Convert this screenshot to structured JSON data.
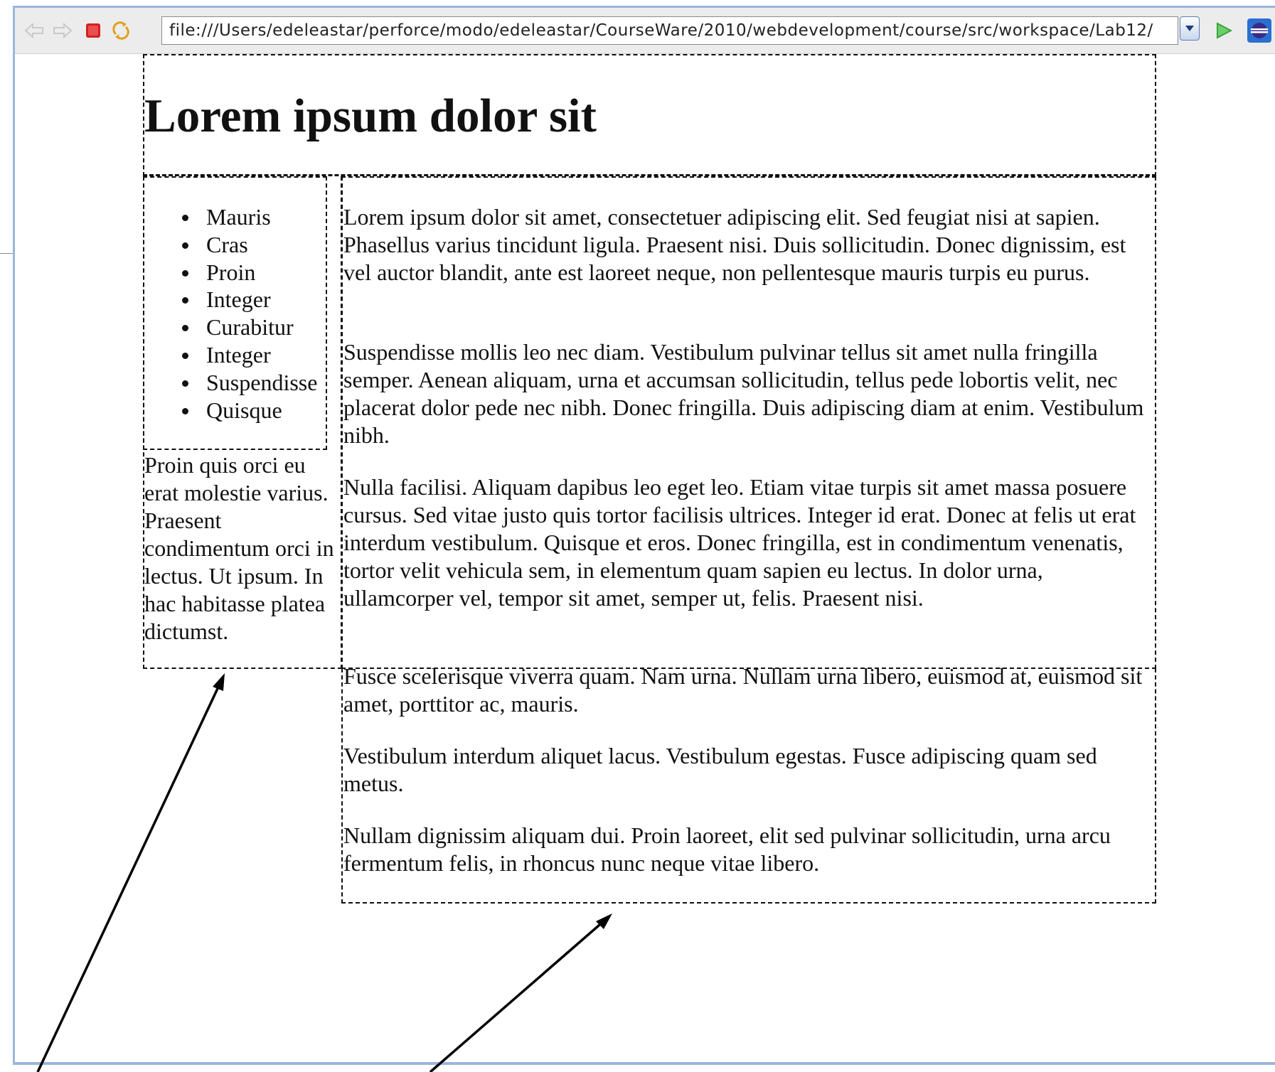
{
  "browser": {
    "url": "file:///Users/edeleastar/perforce/modo/edeleastar/CourseWare/2010/webdevelopment/course/src/workspace/Lab12/",
    "icons": [
      "back-arrow-icon",
      "forward-arrow-icon",
      "stop-icon",
      "refresh-icon",
      "url-dropdown-icon",
      "go-icon",
      "eclipse-icon"
    ],
    "colors": {
      "frame": "#9bb5dc",
      "stop": "#d42020",
      "go": "#3aa53a"
    }
  },
  "page": {
    "title": "Lorem ipsum dolor sit",
    "nav_items": [
      "Mauris",
      "Cras",
      "Proin",
      "Integer",
      "Curabitur",
      "Integer",
      "Suspendisse",
      "Quisque"
    ],
    "sidebar_text": "Proin quis orci eu erat molestie varius. Praesent condimentum orci in lectus. Ut ipsum. In hac habitasse platea dictumst.",
    "paragraphs": [
      "Lorem ipsum dolor sit amet, consectetuer adipiscing elit. Sed feugiat nisi at sapien. Phasellus varius tincidunt ligula. Praesent nisi. Duis sollicitudin. Donec dignissim, est vel auctor blandit, ante est laoreet neque, non pellentesque mauris turpis eu purus.",
      "Suspendisse mollis leo nec diam. Vestibulum pulvinar tellus sit amet nulla fringilla semper. Aenean aliquam, urna et accumsan sollicitudin, tellus pede lobortis velit, nec placerat dolor pede nec nibh. Donec fringilla. Duis adipiscing diam at enim. Vestibulum nibh.",
      "Nulla facilisi. Aliquam dapibus leo eget leo. Etiam vitae turpis sit amet massa posuere cursus. Sed vitae justo quis tortor facilisis ultrices. Integer id erat. Donec at felis ut erat interdum vestibulum. Quisque et eros. Donec fringilla, est in condimentum venenatis, tortor velit vehicula sem, in elementum quam sapien eu lectus. In dolor urna, ullamcorper vel, tempor sit amet, semper ut, felis. Praesent nisi.",
      "Fusce scelerisque viverra quam. Nam urna. Nullam urna libero, euismod at, euismod sit amet, porttitor ac, mauris.",
      "Vestibulum interdum aliquet lacus. Vestibulum egestas. Fusce adipiscing quam sed metus.",
      "Nullam dignissim aliquam dui. Proin laoreet, elit sed pulvinar sollicitudin, urna arcu fermentum felis, in rhoncus nunc neque vitae libero."
    ]
  }
}
